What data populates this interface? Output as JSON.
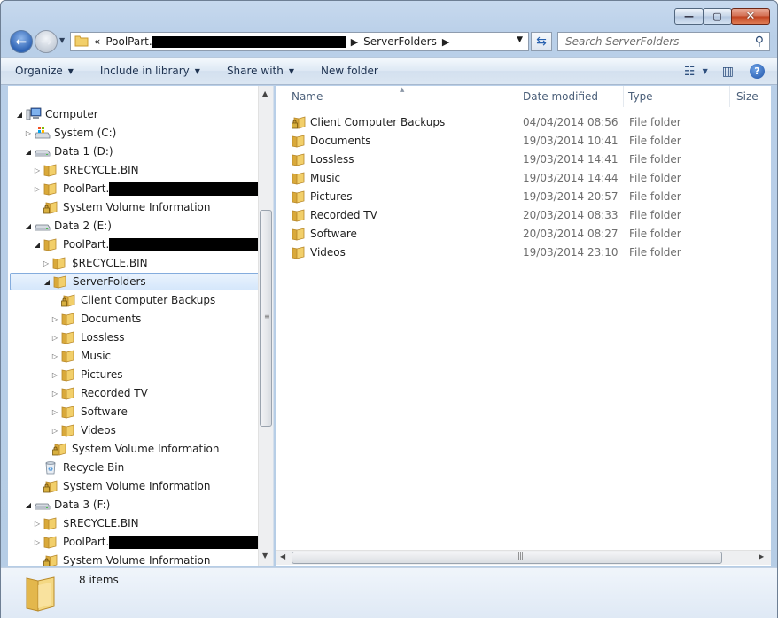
{
  "window": {
    "minimize": "—",
    "maximize": "▢",
    "close": "✕"
  },
  "address": {
    "prefix": "«",
    "segment1": "PoolPart.",
    "segment2": "ServerFolders"
  },
  "search": {
    "placeholder": "Search ServerFolders"
  },
  "toolbar": {
    "organize": "Organize",
    "include_in_library": "Include in library",
    "share_with": "Share with",
    "new_folder": "New folder"
  },
  "nav_tree": [
    {
      "label": "Computer",
      "icon": "computer-icon",
      "expander": "open"
    },
    {
      "label": "System (C:)",
      "icon": "system-drive-icon",
      "expander": "closed"
    },
    {
      "label": "Data 1 (D:)",
      "icon": "drive-icon",
      "expander": "open"
    },
    {
      "label": "$RECYCLE.BIN",
      "icon": "folder-icon",
      "expander": "closed"
    },
    {
      "label": "PoolPart.",
      "icon": "folder-icon",
      "expander": "closed",
      "redacted": true
    },
    {
      "label": "System Volume Information",
      "icon": "locked-folder-icon",
      "expander": "none"
    },
    {
      "label": "Data 2 (E:)",
      "icon": "drive-icon",
      "expander": "open"
    },
    {
      "label": "PoolPart.",
      "icon": "folder-icon",
      "expander": "open",
      "redacted": true
    },
    {
      "label": "$RECYCLE.BIN",
      "icon": "folder-icon",
      "expander": "closed"
    },
    {
      "label": "ServerFolders",
      "icon": "folder-icon",
      "expander": "open",
      "selected": true
    },
    {
      "label": "Client Computer Backups",
      "icon": "locked-folder-icon",
      "expander": "none"
    },
    {
      "label": "Documents",
      "icon": "folder-icon",
      "expander": "closed"
    },
    {
      "label": "Lossless",
      "icon": "folder-icon",
      "expander": "closed"
    },
    {
      "label": "Music",
      "icon": "folder-icon",
      "expander": "closed"
    },
    {
      "label": "Pictures",
      "icon": "folder-icon",
      "expander": "closed"
    },
    {
      "label": "Recorded TV",
      "icon": "folder-icon",
      "expander": "closed"
    },
    {
      "label": "Software",
      "icon": "folder-icon",
      "expander": "closed"
    },
    {
      "label": "Videos",
      "icon": "folder-icon",
      "expander": "closed"
    },
    {
      "label": "System Volume Information",
      "icon": "locked-folder-icon",
      "expander": "none"
    },
    {
      "label": "Recycle Bin",
      "icon": "recycle-bin-icon",
      "expander": "none"
    },
    {
      "label": "System Volume Information",
      "icon": "locked-folder-icon",
      "expander": "none"
    },
    {
      "label": "Data 3 (F:)",
      "icon": "drive-icon",
      "expander": "open"
    },
    {
      "label": "$RECYCLE.BIN",
      "icon": "folder-icon",
      "expander": "closed"
    },
    {
      "label": "PoolPart.",
      "icon": "folder-icon",
      "expander": "closed",
      "redacted": true
    },
    {
      "label": "System Volume Information",
      "icon": "locked-folder-icon",
      "expander": "none"
    }
  ],
  "columns": {
    "name": "Name",
    "date": "Date modified",
    "type": "Type",
    "size": "Size"
  },
  "files": [
    {
      "name": "Client Computer Backups",
      "date": "04/04/2014 08:56",
      "type": "File folder",
      "icon": "locked-folder-icon"
    },
    {
      "name": "Documents",
      "date": "19/03/2014 10:41",
      "type": "File folder",
      "icon": "folder-icon"
    },
    {
      "name": "Lossless",
      "date": "19/03/2014 14:41",
      "type": "File folder",
      "icon": "folder-icon"
    },
    {
      "name": "Music",
      "date": "19/03/2014 14:44",
      "type": "File folder",
      "icon": "folder-icon"
    },
    {
      "name": "Pictures",
      "date": "19/03/2014 20:57",
      "type": "File folder",
      "icon": "folder-icon"
    },
    {
      "name": "Recorded TV",
      "date": "20/03/2014 08:33",
      "type": "File folder",
      "icon": "folder-icon"
    },
    {
      "name": "Software",
      "date": "20/03/2014 08:27",
      "type": "File folder",
      "icon": "folder-icon"
    },
    {
      "name": "Videos",
      "date": "19/03/2014 23:10",
      "type": "File folder",
      "icon": "folder-icon"
    }
  ],
  "details": {
    "count": "8 items"
  },
  "colors": {
    "folder": "#f2cf6a",
    "folder_dark": "#d9a93a",
    "selection": "#d5e7fb",
    "accent": "#2f64b5"
  }
}
